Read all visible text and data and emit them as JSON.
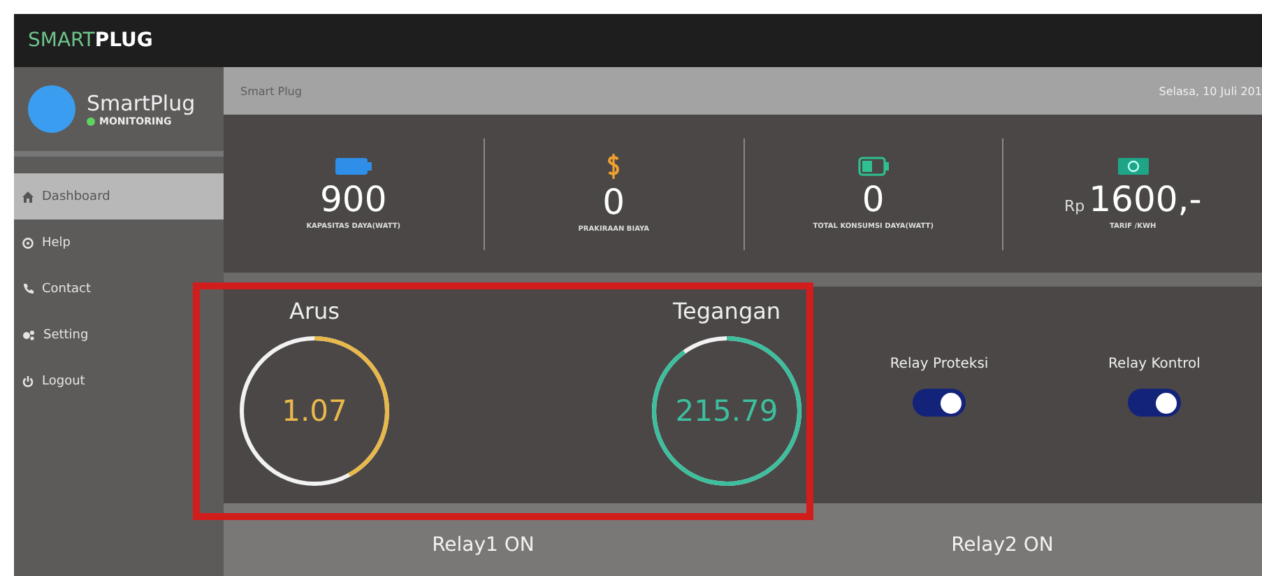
{
  "brand": {
    "light": "SMART",
    "bold": "PLUG"
  },
  "profile": {
    "name": "SmartPlug",
    "status": "MONITORING",
    "online": true
  },
  "sidebar": {
    "items": [
      {
        "label": "Dashboard",
        "selected": true
      },
      {
        "label": "Help",
        "selected": false
      },
      {
        "label": "Contact",
        "selected": false
      },
      {
        "label": "Setting",
        "selected": false
      },
      {
        "label": "Logout",
        "selected": false
      }
    ]
  },
  "breadcrumb": "Smart Plug",
  "date": "Selasa, 10 Juli 201",
  "stats": [
    {
      "value": "900",
      "label": "KAPASITAS DAYA(WATT)"
    },
    {
      "value": "0",
      "label": "PRAKIRAAN BIAYA"
    },
    {
      "value": "0",
      "label": "TOTAL KONSUMSI DAYA(WATT)"
    },
    {
      "prefix": "Rp",
      "value": "1600,-",
      "label": "TARIF /KWH"
    }
  ],
  "gauges": [
    {
      "title": "Arus",
      "value": "1.07",
      "color": "#e8b84a"
    },
    {
      "title": "Tegangan",
      "value": "215.79",
      "color": "#3dbf9e"
    }
  ],
  "relays": [
    {
      "label": "Relay Proteksi",
      "on": true
    },
    {
      "label": "Relay Kontrol",
      "on": true
    }
  ],
  "relay_status": [
    "Relay1 ON",
    "Relay2 ON"
  ],
  "highlight": true
}
